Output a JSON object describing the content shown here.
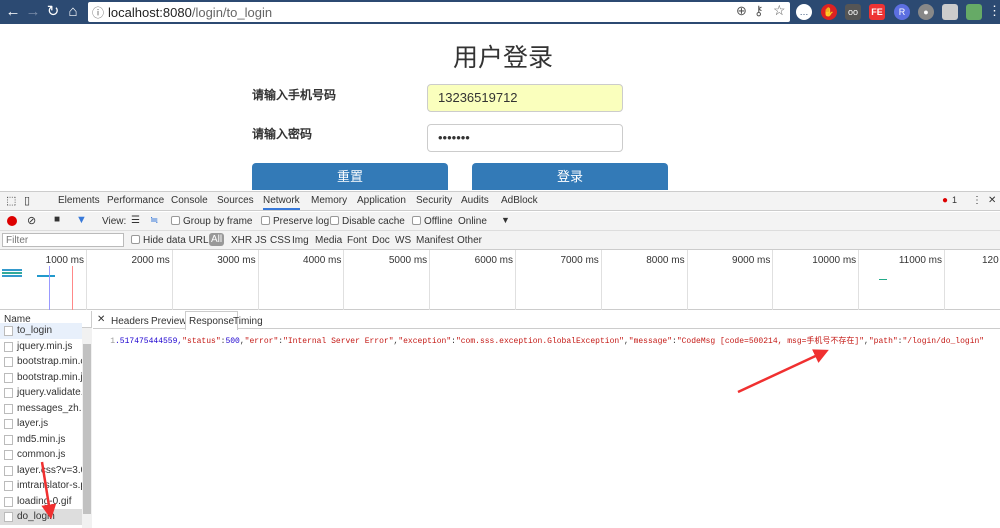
{
  "browser": {
    "url_host": "localhost:8080",
    "url_path": "/login/to_login",
    "extensions": [
      "chat-icon",
      "stop-hand-icon",
      "glasses-icon",
      "fe-icon",
      "r-icon",
      "bulb-icon",
      "screen-icon",
      "avatar-icon"
    ]
  },
  "page": {
    "title": "用户登录",
    "phone_label": "请输入手机号码",
    "phone_value": "13236519712",
    "password_label": "请输入密码",
    "password_value": "•••••••",
    "reset_label": "重置",
    "login_label": "登录"
  },
  "devtools": {
    "tabs": [
      "Elements",
      "Performance",
      "Console",
      "Sources",
      "Network",
      "Memory",
      "Application",
      "Security",
      "Audits",
      "AdBlock"
    ],
    "active_tab": "Network",
    "error_count": "1",
    "toolbar": {
      "view": "View:",
      "group_by_frame": "Group by frame",
      "preserve_log": "Preserve log",
      "disable_cache": "Disable cache",
      "offline": "Offline",
      "throttle": "Online"
    },
    "filter": {
      "placeholder": "Filter",
      "hide_data_urls": "Hide data URLs",
      "types": [
        "All",
        "XHR",
        "JS",
        "CSS",
        "Img",
        "Media",
        "Font",
        "Doc",
        "WS",
        "Manifest",
        "Other"
      ]
    },
    "timeline_ticks": [
      "1000 ms",
      "2000 ms",
      "3000 ms",
      "4000 ms",
      "5000 ms",
      "6000 ms",
      "7000 ms",
      "8000 ms",
      "9000 ms",
      "10000 ms",
      "11000 ms",
      "120"
    ],
    "name_header": "Name",
    "requests": [
      "to_login",
      "jquery.min.js",
      "bootstrap.min.css",
      "bootstrap.min.js",
      "jquery.validate.m",
      "messages_zh.mi",
      "layer.js",
      "md5.min.js",
      "common.js",
      "layer.css?v=3.0.3",
      "imtranslator-s.pr",
      "loading-0.gif",
      "do_login"
    ],
    "detail_tabs": [
      "Headers",
      "Preview",
      "Response",
      "Timing"
    ],
    "active_detail_tab": "Response",
    "response": {
      "line": "1",
      "p1": ".517475444559,",
      "k_status": "\"status\"",
      "v_status": "500",
      "k_error": "\"error\"",
      "v_error": "\"Internal Server Error\"",
      "k_exc": "\"exception\"",
      "v_exc": "\"com.sss.exception.GlobalException\"",
      "k_msg": "\"message\"",
      "v_msg": "\"CodeMsg [code=500214, msg=手机号不存在]\"",
      "k_path": "\"path\"",
      "v_path": "\"/login/do_login\""
    }
  },
  "colors": {
    "brand": "#337ab7",
    "error": "#c80000",
    "annotation_arrow": "#f03030"
  }
}
